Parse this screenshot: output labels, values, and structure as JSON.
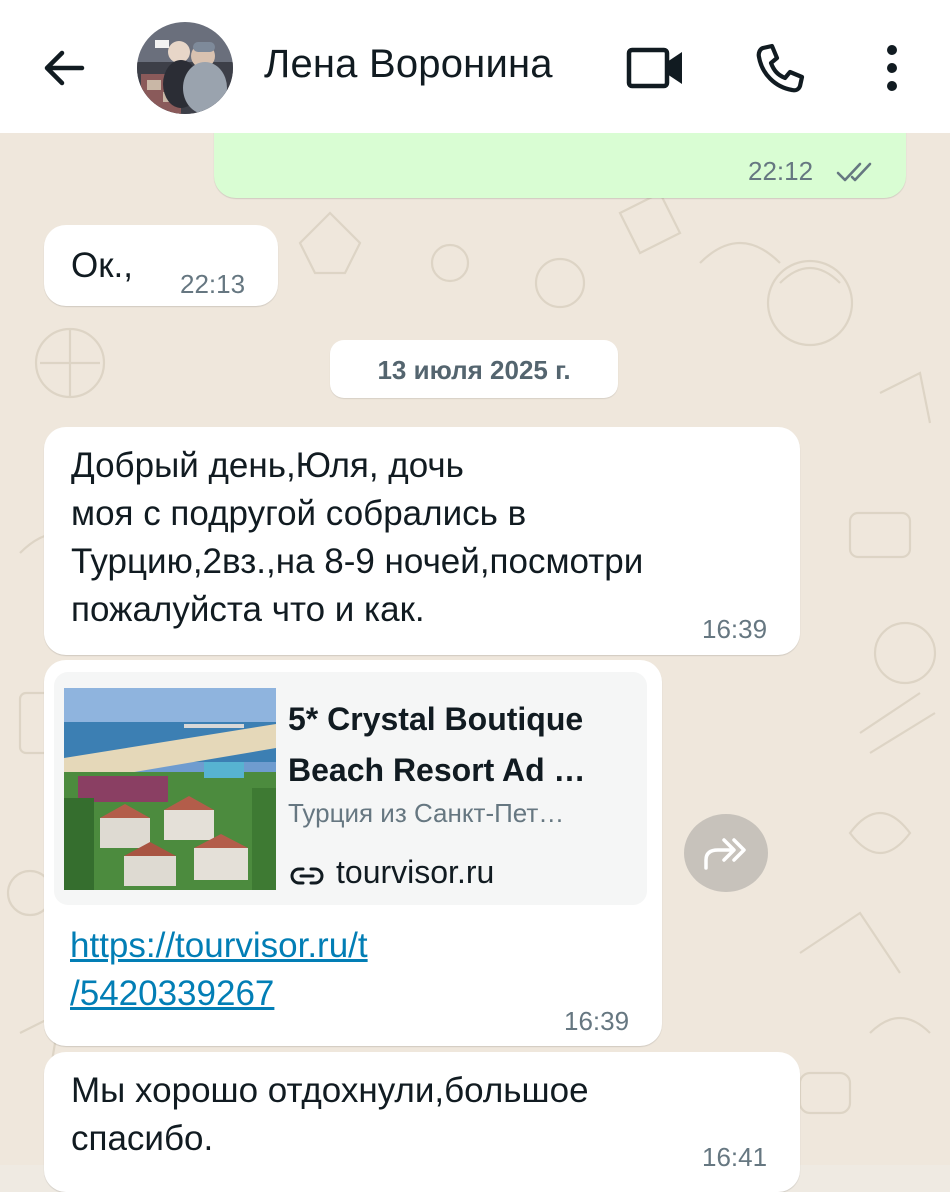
{
  "header": {
    "contact_name": "Лена Воронина",
    "back_icon": "arrow-left-icon",
    "video_icon": "video-camera-icon",
    "call_icon": "phone-icon",
    "menu_icon": "more-vertical-icon"
  },
  "messages": [
    {
      "direction": "out",
      "text": "",
      "time": "22:12",
      "status": "read"
    },
    {
      "direction": "in",
      "text": "Ок.,",
      "time": "22:13"
    },
    {
      "type": "date",
      "text": "13 июля 2025 г."
    },
    {
      "direction": "in",
      "lines": [
        "Добрый день,Юля, дочь",
        "моя с подругой собрались в",
        "Турцию,2вз.,на 8-9 ночей,посмотри",
        "пожалуйста что и как."
      ],
      "time": "16:39"
    },
    {
      "direction": "in",
      "link_preview": {
        "title_lines": [
          "5* Crystal Boutique",
          "Beach Resort Ad …"
        ],
        "description": "Турция из Санкт-Пет…",
        "domain": "tourvisor.ru"
      },
      "link_lines": [
        "https://tourvisor.ru/t",
        "/5420339267"
      ],
      "time": "16:39"
    },
    {
      "direction": "in",
      "lines": [
        "Мы хорошо отдохнули,большое",
        "спасибо."
      ],
      "time": "16:41"
    }
  ],
  "colors": {
    "outgoing_bubble": "#d9fdd3",
    "incoming_bubble": "#ffffff",
    "wallpaper": "#efe7dc",
    "link": "#027eb5",
    "read_ticks": "#667781"
  }
}
